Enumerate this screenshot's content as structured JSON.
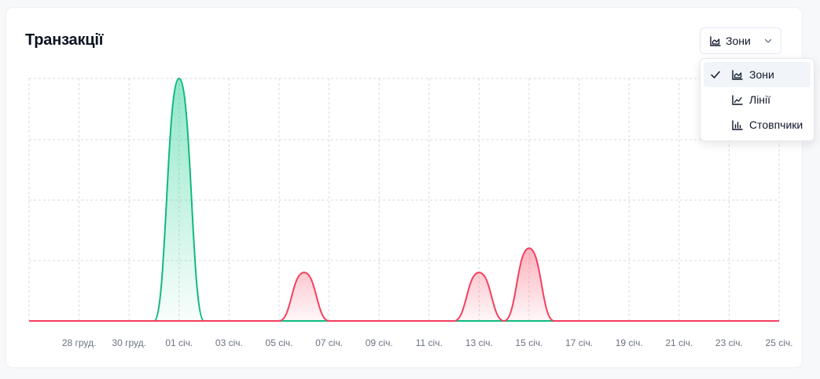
{
  "card": {
    "title": "Транзакції"
  },
  "view_select": {
    "selected_label": "Зони",
    "selected_icon": "area-chart-icon",
    "options": [
      {
        "label": "Зони",
        "icon": "area-chart-icon",
        "selected": true
      },
      {
        "label": "Лінії",
        "icon": "line-chart-icon",
        "selected": false
      },
      {
        "label": "Стовпчики",
        "icon": "bar-chart-icon",
        "selected": false
      }
    ]
  },
  "chart_data": {
    "type": "area",
    "x_tick_labels": [
      "28 груд.",
      "30 груд.",
      "01 січ.",
      "03 січ.",
      "05 січ.",
      "07 січ.",
      "09 січ.",
      "11 січ.",
      "13 січ.",
      "15 січ.",
      "17 січ.",
      "19 січ.",
      "21 січ.",
      "23 січ.",
      "25 січ."
    ],
    "x": [
      "26 груд.",
      "27 груд.",
      "28 груд.",
      "29 груд.",
      "30 груд.",
      "31 груд.",
      "01 січ.",
      "02 січ.",
      "03 січ.",
      "04 січ.",
      "05 січ.",
      "06 січ.",
      "07 січ.",
      "08 січ.",
      "09 січ.",
      "10 січ.",
      "11 січ.",
      "12 січ.",
      "13 січ.",
      "14 січ.",
      "15 січ.",
      "16 січ.",
      "17 січ.",
      "18 січ.",
      "19 січ.",
      "20 січ.",
      "21 січ.",
      "22 січ.",
      "23 січ.",
      "24 січ.",
      "25 січ."
    ],
    "series": [
      {
        "color": "#10b981",
        "fill": "#34d399",
        "values": [
          0,
          0,
          0,
          0,
          0,
          0,
          100,
          0,
          0,
          0,
          0,
          0,
          0,
          0,
          0,
          0,
          0,
          0,
          0,
          0,
          0,
          0,
          0,
          0,
          0,
          0,
          0,
          0,
          0,
          0,
          0
        ]
      },
      {
        "color": "#f43f5e",
        "fill": "#fb7185",
        "values": [
          0,
          0,
          0,
          0,
          0,
          0,
          0,
          0,
          0,
          0,
          0,
          20,
          0,
          0,
          0,
          0,
          0,
          0,
          20,
          0,
          30,
          0,
          0,
          0,
          0,
          0,
          0,
          0,
          0,
          0,
          0
        ]
      }
    ],
    "ylim": [
      0,
      100
    ],
    "grid": true,
    "grid_style": "dashed",
    "legend": false
  }
}
